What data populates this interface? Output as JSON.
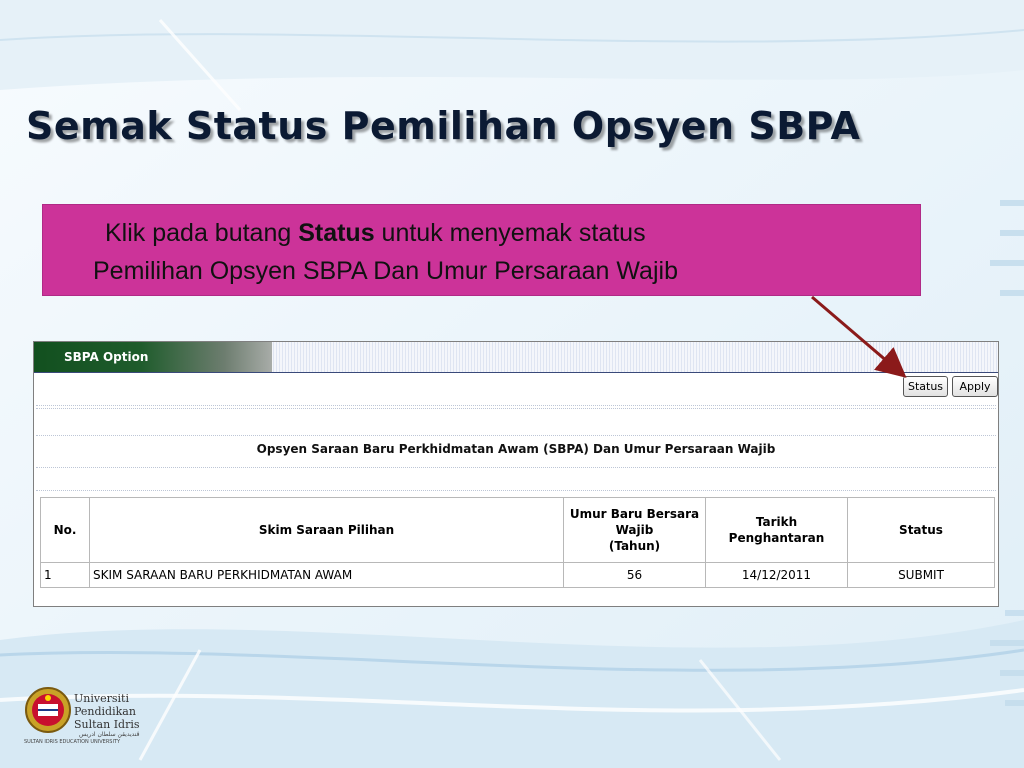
{
  "slide": {
    "title": "Semak Status Pemilihan Opsyen SBPA",
    "callout": {
      "line1_prefix": "Klik pada butang ",
      "line1_bold": "Status",
      "line1_suffix": " untuk menyemak status",
      "line2": "Pemilihan Opsyen SBPA Dan Umur Persaraan Wajib",
      "color": "#cc3399"
    },
    "arrow_color": "#8b1a1a"
  },
  "window": {
    "tab_label": "SBPA Option",
    "buttons": {
      "status": "Status",
      "apply": "Apply"
    },
    "heading": "Opsyen Saraan Baru Perkhidmatan Awam (SBPA) Dan Umur Persaraan Wajib",
    "table": {
      "headers": {
        "no": "No.",
        "skim": "Skim Saraan Pilihan",
        "umur_l1": "Umur Baru Bersara",
        "umur_l2": "Wajib",
        "umur_l3": "(Tahun)",
        "tarikh_l1": "Tarikh",
        "tarikh_l2": "Penghantaran",
        "status": "Status"
      },
      "rows": [
        {
          "no": "1",
          "skim": "SKIM SARAAN BARU PERKHIDMATAN AWAM",
          "umur": "56",
          "tarikh": "14/12/2011",
          "status": "SUBMIT"
        }
      ]
    }
  },
  "logo": {
    "line1": "Universiti",
    "line2": "Pendidikan",
    "line3": "Sultan Idris",
    "jawi": "ڤنديديقن سلطان ادريس",
    "subtitle": "SULTAN IDRIS EDUCATION UNIVERSITY"
  }
}
